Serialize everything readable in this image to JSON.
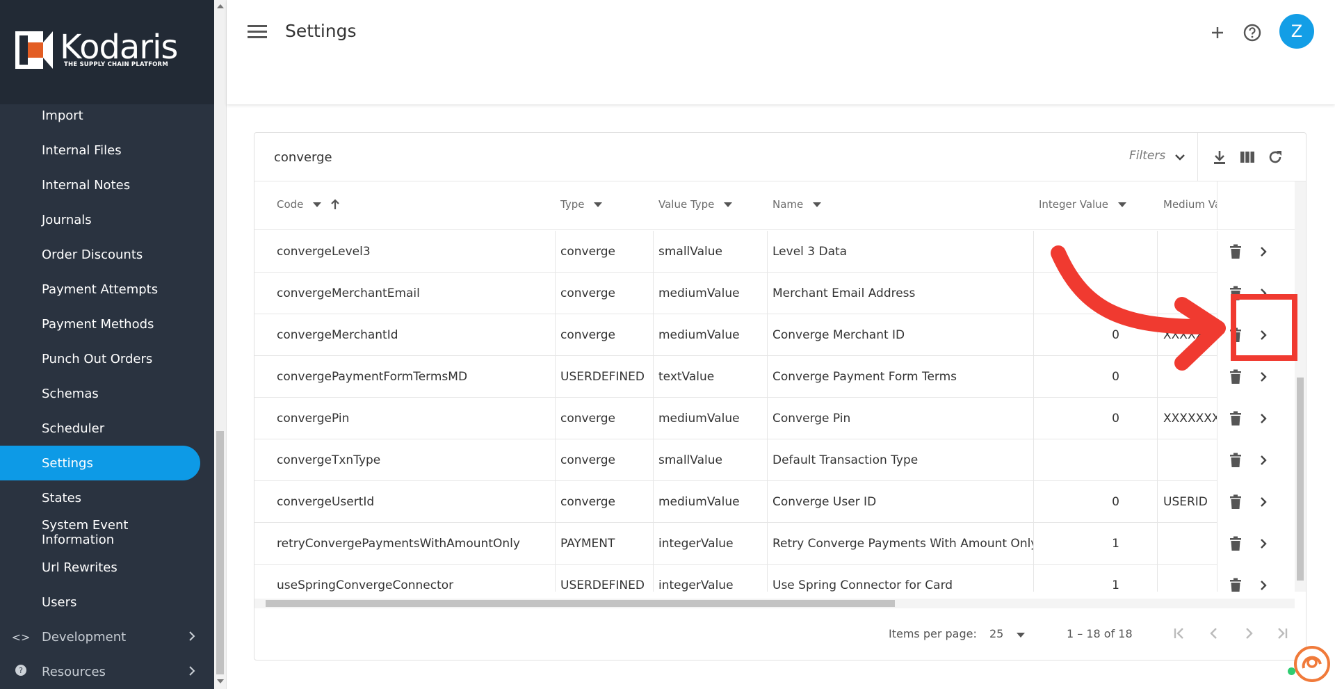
{
  "brand": {
    "name": "Kodaris",
    "tagline": "THE SUPPLY CHAIN PLATFORM",
    "logo_color": "#e35d23"
  },
  "sidebar": {
    "items": [
      {
        "label": "Import"
      },
      {
        "label": "Internal Files"
      },
      {
        "label": "Internal Notes"
      },
      {
        "label": "Journals"
      },
      {
        "label": "Order Discounts"
      },
      {
        "label": "Payment Attempts"
      },
      {
        "label": "Payment Methods"
      },
      {
        "label": "Punch Out Orders"
      },
      {
        "label": "Schemas"
      },
      {
        "label": "Scheduler"
      },
      {
        "label": "Settings",
        "active": true
      },
      {
        "label": "States"
      },
      {
        "label": "System Event Information"
      },
      {
        "label": "Url Rewrites"
      },
      {
        "label": "Users"
      }
    ],
    "groups": [
      {
        "label": "Development",
        "icon": "code-icon"
      },
      {
        "label": "Resources",
        "icon": "help-circle-icon"
      }
    ],
    "active_color": "#0d9ae6"
  },
  "header": {
    "title": "Settings",
    "avatar_initial": "Z",
    "avatar_color": "#139ee6"
  },
  "toolbar": {
    "search_value": "converge",
    "filters_label": "Filters"
  },
  "table": {
    "columns": [
      "Code",
      "Type",
      "Value Type",
      "Name",
      "Integer Value",
      "Medium Va"
    ],
    "rows": [
      {
        "code": "convergeLevel3",
        "type": "converge",
        "value_type": "smallValue",
        "name": "Level 3 Data",
        "integer": "",
        "medium": ""
      },
      {
        "code": "convergeMerchantEmail",
        "type": "converge",
        "value_type": "mediumValue",
        "name": "Merchant Email Address",
        "integer": "",
        "medium": ""
      },
      {
        "code": "convergeMerchantId",
        "type": "converge",
        "value_type": "mediumValue",
        "name": "Converge Merchant ID",
        "integer": "0",
        "medium": "XXXXXX"
      },
      {
        "code": "convergePaymentFormTermsMD",
        "type": "USERDEFINED",
        "value_type": "textValue",
        "name": "Converge Payment Form Terms",
        "integer": "0",
        "medium": ""
      },
      {
        "code": "convergePin",
        "type": "converge",
        "value_type": "mediumValue",
        "name": "Converge Pin",
        "integer": "0",
        "medium": "XXXXXXX"
      },
      {
        "code": "convergeTxnType",
        "type": "converge",
        "value_type": "smallValue",
        "name": "Default Transaction Type",
        "integer": "",
        "medium": ""
      },
      {
        "code": "convergeUsertId",
        "type": "converge",
        "value_type": "mediumValue",
        "name": "Converge User ID",
        "integer": "0",
        "medium": "USERID"
      },
      {
        "code": "retryConvergePaymentsWithAmountOnly",
        "type": "PAYMENT",
        "value_type": "integerValue",
        "name": "Retry Converge Payments With Amount Only",
        "integer": "1",
        "medium": ""
      },
      {
        "code": "useSpringConvergeConnector",
        "type": "USERDEFINED",
        "value_type": "integerValue",
        "name": "Use Spring Connector for Card",
        "integer": "1",
        "medium": ""
      }
    ]
  },
  "paginator": {
    "items_per_page_label": "Items per page:",
    "items_per_page_value": "25",
    "range_label": "1 – 18 of 18"
  },
  "annotation": {
    "color": "#f03a30"
  }
}
